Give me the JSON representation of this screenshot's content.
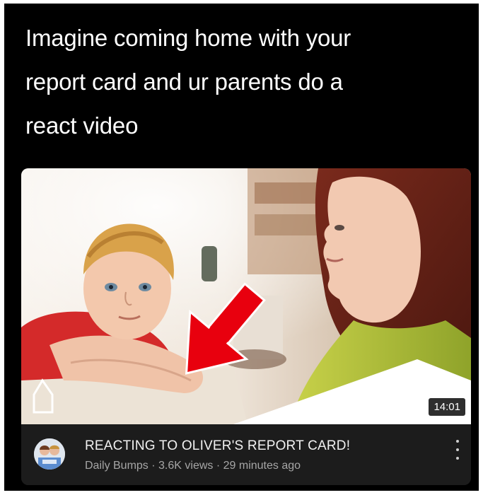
{
  "caption": {
    "lines": [
      "Imagine coming home with your",
      "report card and ur parents do a",
      "react video"
    ]
  },
  "video": {
    "duration": "14:01",
    "title": "REACTING TO OLIVER'S REPORT CARD!",
    "channel": "Daily Bumps",
    "views": "3.6K views",
    "age": "29 minutes ago",
    "separator": " · ",
    "thumbnail_arrow_color": "#e8000e",
    "more_icon": "more-vert-icon"
  }
}
